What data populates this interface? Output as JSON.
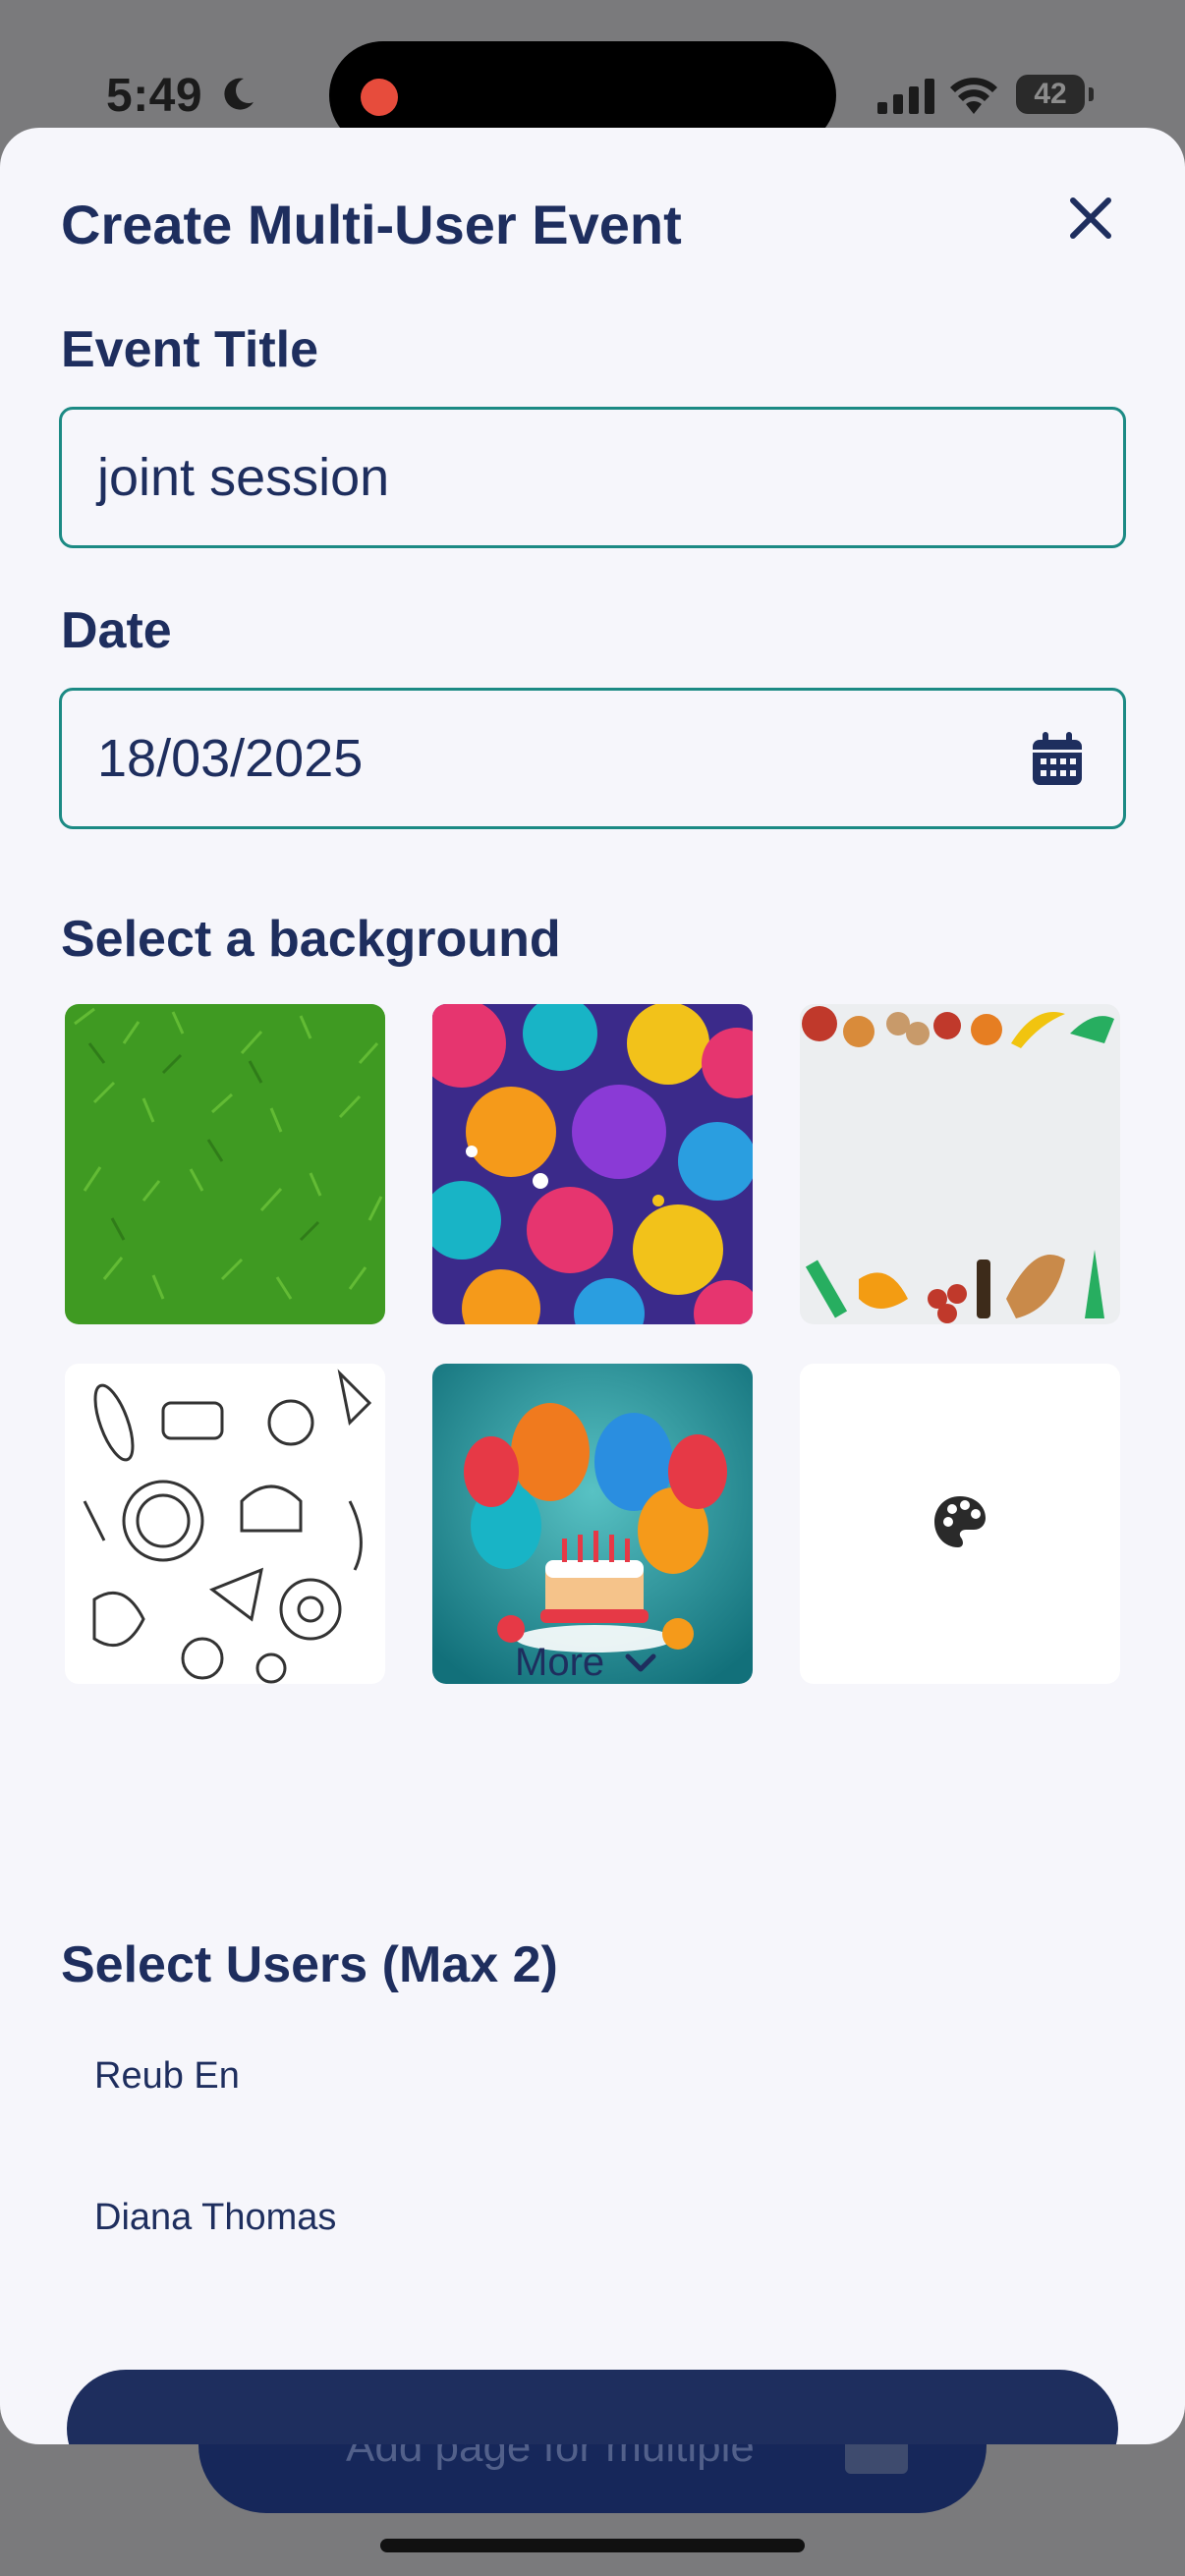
{
  "status_bar": {
    "time": "5:49",
    "battery": "42"
  },
  "sheet": {
    "title": "Create Multi-User Event",
    "event_title": {
      "label": "Event Title",
      "value": "joint session"
    },
    "date": {
      "label": "Date",
      "value": "18/03/2025"
    },
    "background": {
      "label": "Select a background",
      "options": [
        "grass",
        "balloons",
        "vegetables",
        "food-doodles",
        "birthday-cake",
        "custom-palette"
      ]
    },
    "more_label": "More",
    "users": {
      "label": "Select Users (Max 2)",
      "items": [
        "Reub En",
        "Diana Thomas"
      ]
    }
  },
  "underlying_page": {
    "button_label": "Add page for multiple"
  },
  "colors": {
    "primary": "#1e2e5e",
    "field_border": "#1c8a84",
    "sheet_bg": "#f6f6fb"
  }
}
